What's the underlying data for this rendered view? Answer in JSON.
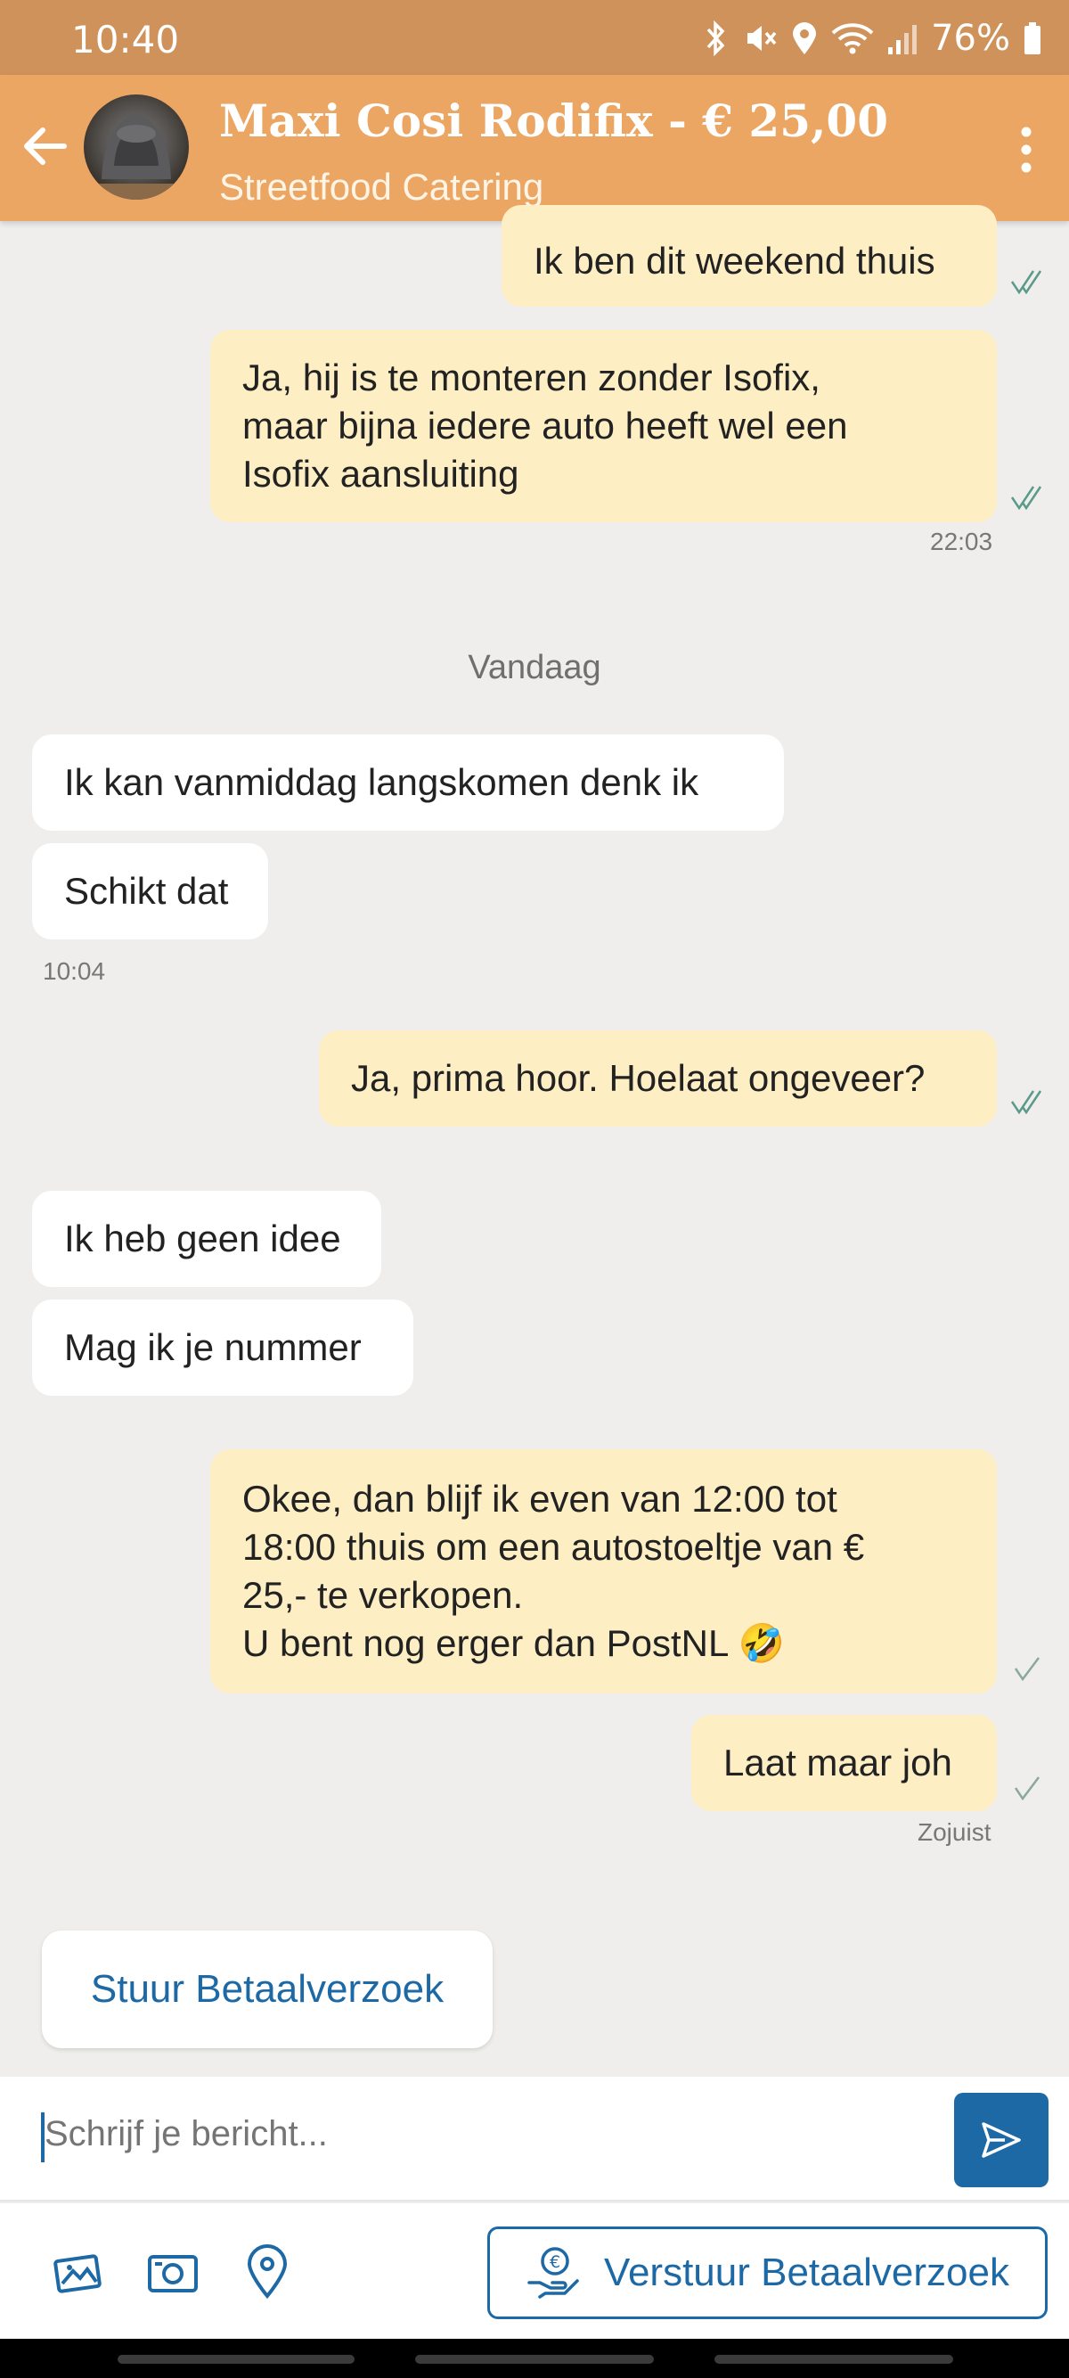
{
  "status_bar": {
    "time": "10:40",
    "battery": "76%",
    "icons": [
      "bluetooth-icon",
      "mute-icon",
      "location-icon",
      "wifi-icon",
      "signal-icon",
      "battery-icon"
    ]
  },
  "header": {
    "title": "Maxi Cosi Rodifix - € 25,00",
    "subtitle": "Streetfood Catering",
    "back_icon": "arrow-left-icon",
    "menu_icon": "more-vertical-icon"
  },
  "messages": [
    {
      "direction": "out",
      "lines": [
        "Ik ben dit weekend thuis"
      ],
      "status": "read"
    },
    {
      "direction": "out",
      "lines": [
        "Ja, hij is te monteren zonder Isofix,",
        "maar bijna iedere auto heeft wel een",
        "Isofix aansluiting"
      ],
      "status": "read",
      "time": "22:03"
    },
    {
      "direction": "in",
      "lines": [
        "Ik kan vanmiddag langskomen denk ik"
      ]
    },
    {
      "direction": "in",
      "lines": [
        "Schikt dat"
      ],
      "time": "10:04"
    },
    {
      "direction": "out",
      "lines": [
        "Ja, prima hoor. Hoelaat ongeveer?"
      ],
      "status": "read"
    },
    {
      "direction": "in",
      "lines": [
        "Ik heb geen idee"
      ]
    },
    {
      "direction": "in",
      "lines": [
        "Mag ik je nummer"
      ]
    },
    {
      "direction": "out",
      "lines": [
        "Okee, dan blijf ik even van 12:00 tot",
        "18:00 thuis om een autostoeltje van €",
        "25,- te verkopen.",
        "U bent nog erger dan PostNL 🤣"
      ],
      "status": "sent"
    },
    {
      "direction": "out",
      "lines": [
        "Laat maar joh"
      ],
      "status": "sent",
      "time": "Zojuist"
    }
  ],
  "day_separator": "Vandaag",
  "payment_card": {
    "label": "Stuur Betaalverzoek"
  },
  "composer": {
    "placeholder": "Schrijf je bericht...",
    "value": ""
  },
  "toolbar": {
    "icons": [
      "gallery-icon",
      "camera-icon",
      "location-pin-icon"
    ],
    "pay_button_label": "Verstuur Betaalverzoek"
  },
  "colors": {
    "status_bar": "#cf925a",
    "app_bar": "#eca664",
    "outgoing_bubble": "#fdeec4",
    "incoming_bubble": "#ffffff",
    "accent": "#1d69a6",
    "background": "#efeeec",
    "read_tick": "#5b9a8a",
    "sent_tick": "#8aa7a0"
  }
}
